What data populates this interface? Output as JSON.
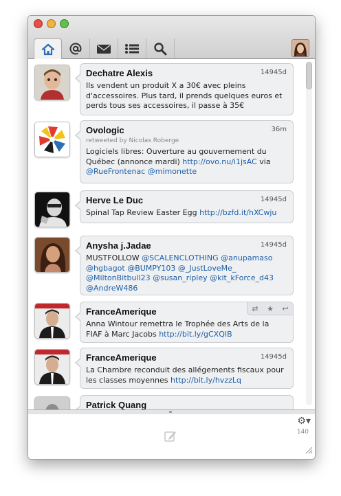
{
  "colors": {
    "close": "#ec4b46",
    "minimize": "#f3b33c",
    "zoom": "#5fc14a",
    "link": "#1d5fa8"
  },
  "toolbar": {
    "tabs": [
      {
        "icon": "home-icon"
      },
      {
        "icon": "at-mentions-icon"
      },
      {
        "icon": "envelope-icon"
      },
      {
        "icon": "list-icon"
      },
      {
        "icon": "search-icon"
      }
    ]
  },
  "tweets": [
    {
      "name": "Dechatre Alexis",
      "time": "14945d",
      "text": "Ils vendent un produit X a 30€ avec pleins d'accessoires. Plus tard, il prends quelques euros et perds tous ses accessoires, il passe à 35€"
    },
    {
      "name": "Ovologic",
      "time": "36m",
      "retweet": "retweeted by Nicolas Roberge",
      "text": "Logiciels libres: Ouverture au gouvernement du Québec (annonce mardi) ",
      "link": "http://ovo.nu/i1jsAC",
      "text2": " via",
      "mentions": "@RueFrontenac @mimonette"
    },
    {
      "name": "Herve Le Duc",
      "time": "14945d",
      "text": "Spinal Tap Review Easter Egg ",
      "link": "http://bzfd.it/hXCwju"
    },
    {
      "name": "Anysha j.Jadae",
      "time": "14945d",
      "text": "MUSTFOLLOW ",
      "mentions": "@SCALENCLOTHING @anupamaso @hgbagot @BUMPY103 @_JustLoveMe_ @MiltonBitbull23 @susan_ripley @kit_kForce_d43 @AndreW486"
    },
    {
      "name": "FranceAmerique",
      "text": "Anna Wintour remettra le Trophée des Arts de la FIAF à Marc Jacobs ",
      "link": "http://bit.ly/gCXQIB"
    },
    {
      "name": "FranceAmerique",
      "time": "14945d",
      "text": "La Chambre reconduit des allégements fiscaux pour les classes moyennes ",
      "link": "http://bit.ly/hvzzLq"
    },
    {
      "name": "Patrick Quang"
    }
  ],
  "compose": {
    "char_count": "140",
    "gear_icon": "gear-icon"
  }
}
